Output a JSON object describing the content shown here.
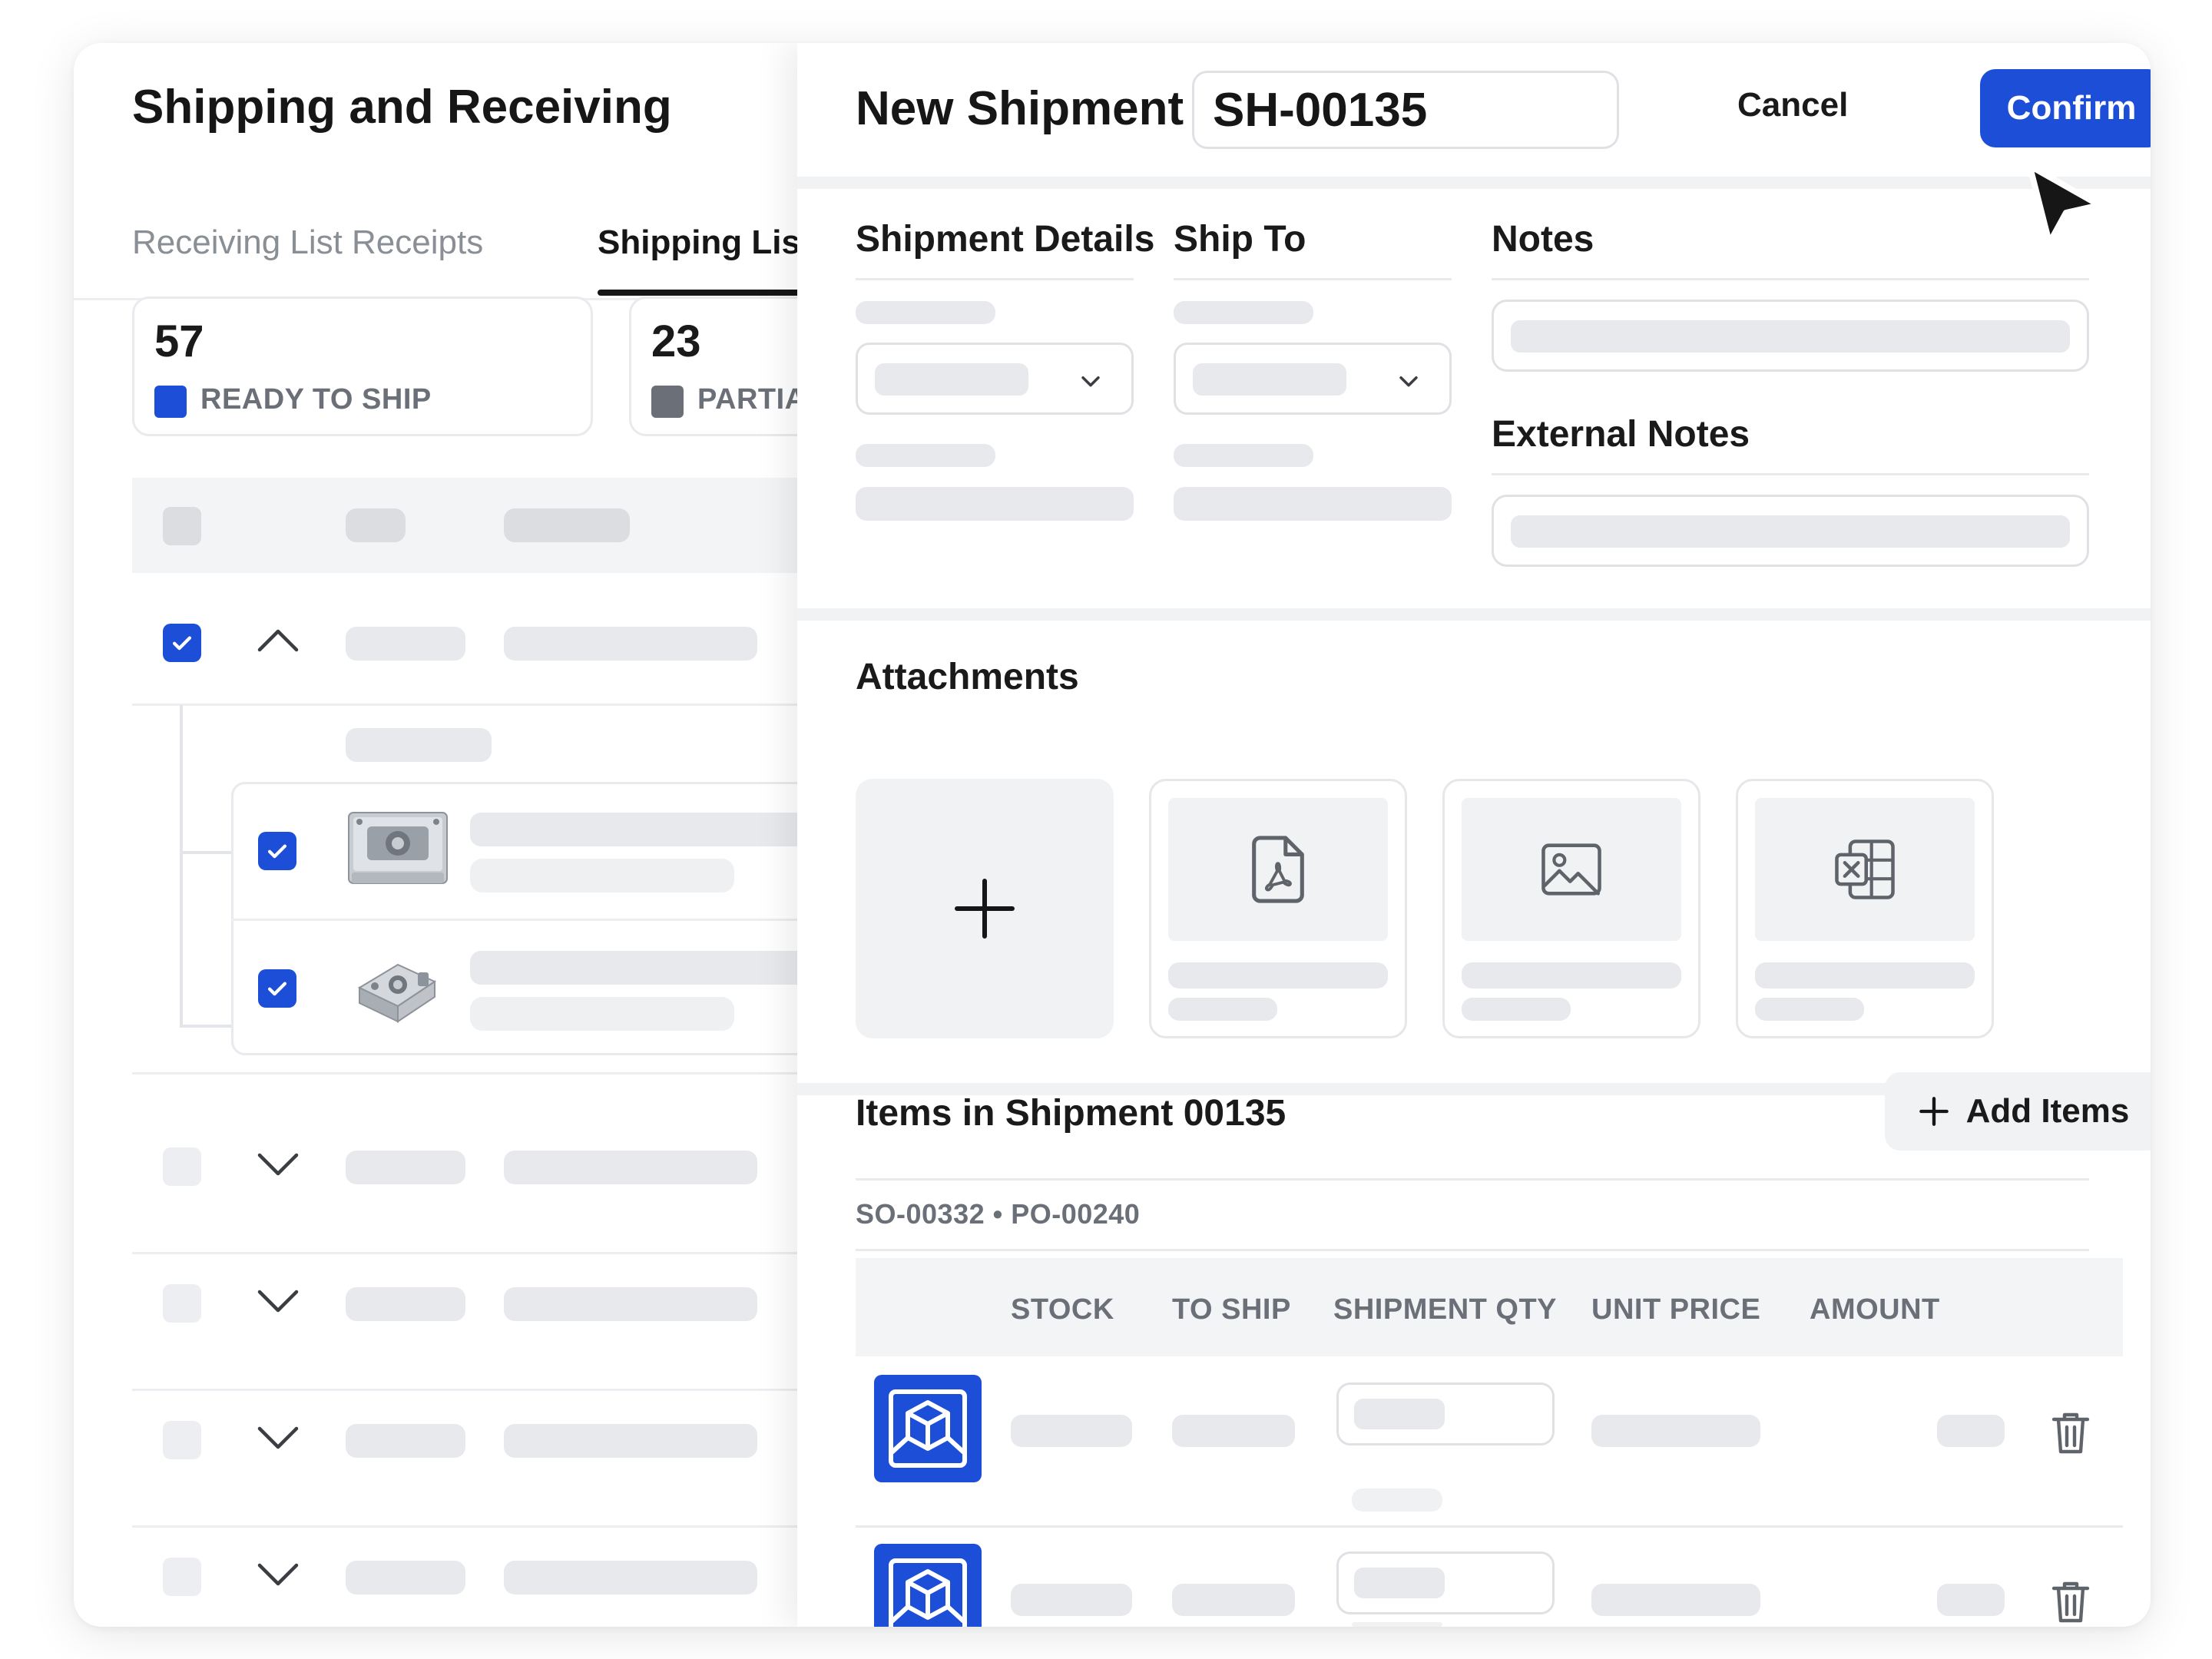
{
  "left_panel": {
    "title": "Shipping and Receiving",
    "tabs": [
      {
        "label": "Receiving List",
        "active": false
      },
      {
        "label": "Receipts",
        "active": false
      },
      {
        "label": "Shipping List",
        "active": true
      }
    ],
    "stats": [
      {
        "value": "57",
        "label": "READY TO SHIP",
        "color": "#1d4ed8"
      },
      {
        "value": "23",
        "label": "PARTIA",
        "color": "#6b7078"
      }
    ]
  },
  "shipment": {
    "title": "New Shipment",
    "id_value": "SH-00135",
    "cancel_label": "Cancel",
    "confirm_label": "Confirm",
    "sections": {
      "details_label": "Shipment Details",
      "ship_to_label": "Ship To",
      "notes_label": "Notes",
      "external_notes_label": "External Notes",
      "attachments_label": "Attachments",
      "items_label": "Items in Shipment 00135"
    },
    "add_items_label": "Add Items",
    "order_ref": "SO-00332 • PO-00240",
    "columns": [
      "STOCK",
      "TO SHIP",
      "SHIPMENT QTY",
      "UNIT PRICE",
      "AMOUNT"
    ]
  },
  "colors": {
    "accent": "#1d4ed8",
    "placeholder": "#e8e9ec",
    "muted_text": "#6b7078"
  },
  "icons": {
    "attachments": [
      "plus-icon",
      "pdf-file-icon",
      "image-file-icon",
      "excel-file-icon"
    ],
    "item": "box-3d-icon",
    "row_action": "trash-icon",
    "cursor": "mouse-pointer-icon"
  }
}
